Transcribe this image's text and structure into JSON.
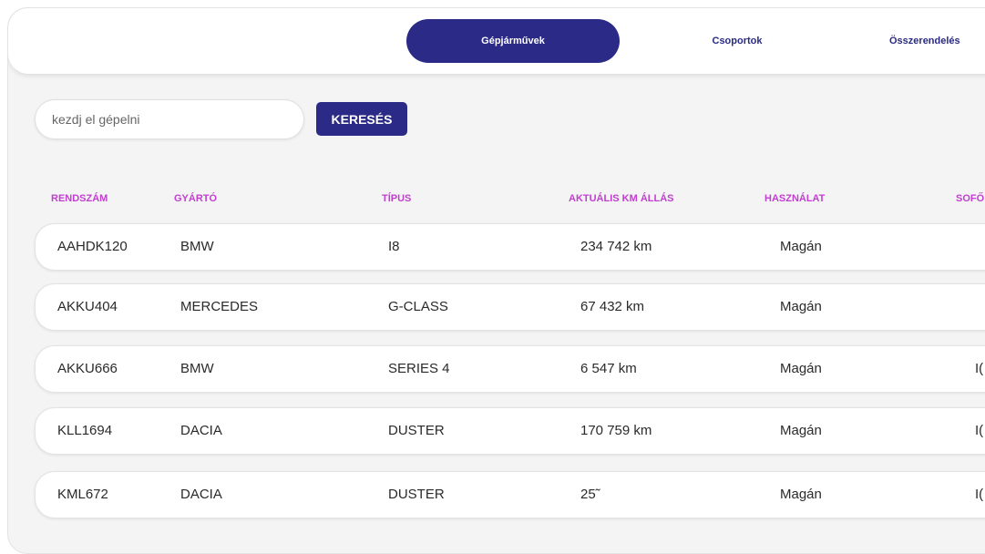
{
  "tabs": [
    {
      "label": "Gépjárművek",
      "active": true
    },
    {
      "label": "Csoportok",
      "active": false
    },
    {
      "label": "Összerendelés",
      "active": false
    }
  ],
  "search": {
    "placeholder": "kezdj el gépelni",
    "button": "KERESÉS"
  },
  "columns": [
    "RENDSZÁM",
    "GYÁRTÓ",
    "TÍPUS",
    "AKTUÁLIS KM ÁLLÁS",
    "HASZNÁLAT",
    "SOFŐ"
  ],
  "rows": [
    {
      "plate": "AAHDK120",
      "maker": "BMW",
      "type": "I8",
      "km": "234 742 km",
      "usage": "Magán",
      "driver": ""
    },
    {
      "plate": "AKKU404",
      "maker": "MERCEDES",
      "type": "G-CLASS",
      "km": "67 432 km",
      "usage": "Magán",
      "driver": ""
    },
    {
      "plate": "AKKU666",
      "maker": "BMW",
      "type": "SERIES 4",
      "km": "6 547 km",
      "usage": "Magán",
      "driver": "I("
    },
    {
      "plate": "KLL1694",
      "maker": "DACIA",
      "type": "DUSTER",
      "km": "170 759 km",
      "usage": "Magán",
      "driver": "I("
    },
    {
      "plate": "KML672",
      "maker": "DACIA",
      "type": "DUSTER",
      "km": "25˜",
      "usage": "Magán",
      "driver": "I("
    }
  ],
  "colors": {
    "accent": "#2b2a86",
    "header_text": "#c13fcf",
    "background": "#f4f4f5"
  }
}
